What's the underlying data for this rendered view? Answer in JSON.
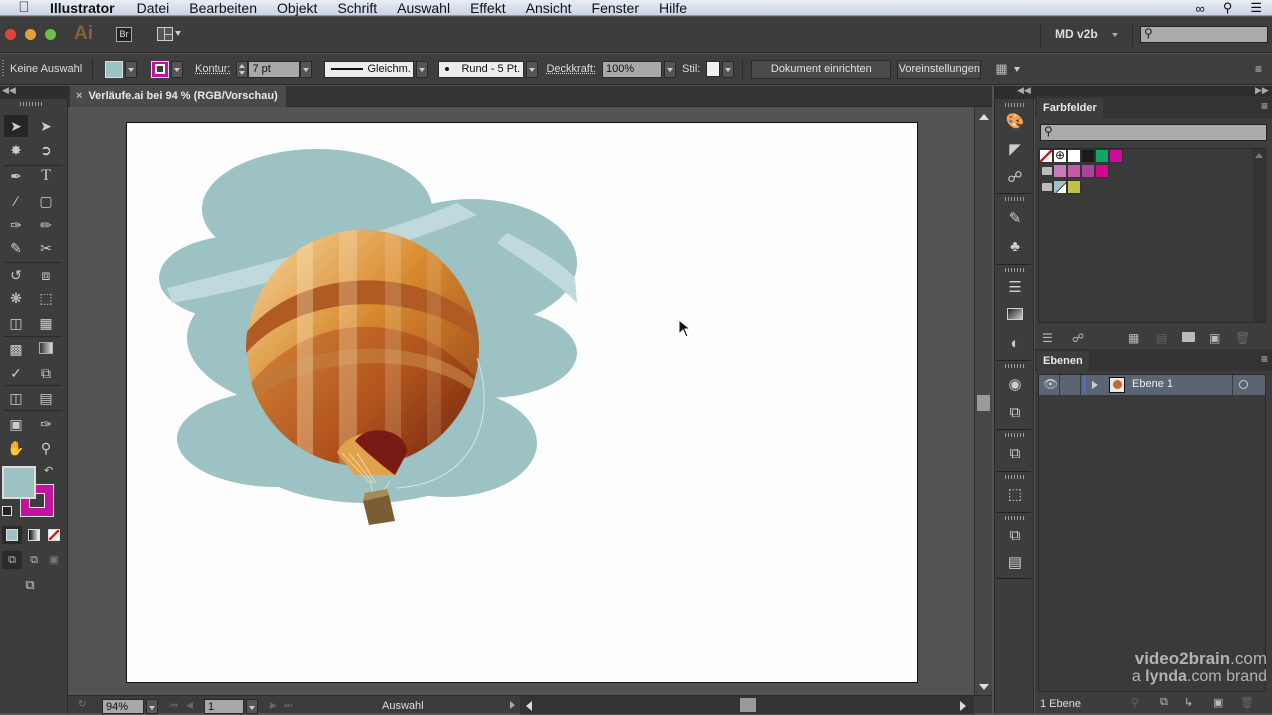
{
  "menubar": {
    "app_name": "Illustrator",
    "items": [
      "Datei",
      "Bearbeiten",
      "Objekt",
      "Schrift",
      "Auswahl",
      "Effekt",
      "Ansicht",
      "Fenster",
      "Hilfe"
    ]
  },
  "appbar": {
    "logo": "Ai",
    "bridge_label": "Br",
    "workspace": "MD v2b",
    "search_placeholder": ""
  },
  "control": {
    "selection_status": "Keine Auswahl",
    "fill_color": "#9cc2c4",
    "stroke_color": "#c4129c",
    "kontur_label": "Kontur:",
    "kontur_value": "7 pt",
    "stroke_profile": "Gleichm.",
    "brush": "Rund - 5 Pt.",
    "opacity_label": "Deckkraft:",
    "opacity_value": "100%",
    "style_label": "Stil:",
    "doc_setup_button": "Dokument einrichten",
    "preferences_button": "Voreinstellungen"
  },
  "document": {
    "tab_title": "Verläufe.ai bei 94 % (RGB/Vorschau)",
    "zoom": "94%",
    "artboard": "1",
    "status": "Auswahl"
  },
  "tools": {
    "fill": "#9cc2c4",
    "stroke": "#c4129c"
  },
  "swatches": {
    "title": "Farbfelder",
    "search_placeholder": "",
    "row1": [
      "none",
      "registration",
      "#ffffff",
      "#1a1a1a",
      "#0fa66a",
      "#d0099c"
    ],
    "row2": [
      "#c97bbb",
      "#c65aa5",
      "#a84599",
      "#d2088f"
    ],
    "row3": [
      "#9cc2c4",
      "#c2c24a"
    ]
  },
  "layers": {
    "title": "Ebenen",
    "items": [
      {
        "name": "Ebene 1",
        "color": "#4a6cd4"
      }
    ],
    "count": "1 Ebene"
  },
  "watermark": {
    "line1_bold": "video2brain",
    "line1_rest": ".com",
    "line2_pre": "a ",
    "line2_bold": "lynda",
    "line2_rest": ".com brand"
  }
}
